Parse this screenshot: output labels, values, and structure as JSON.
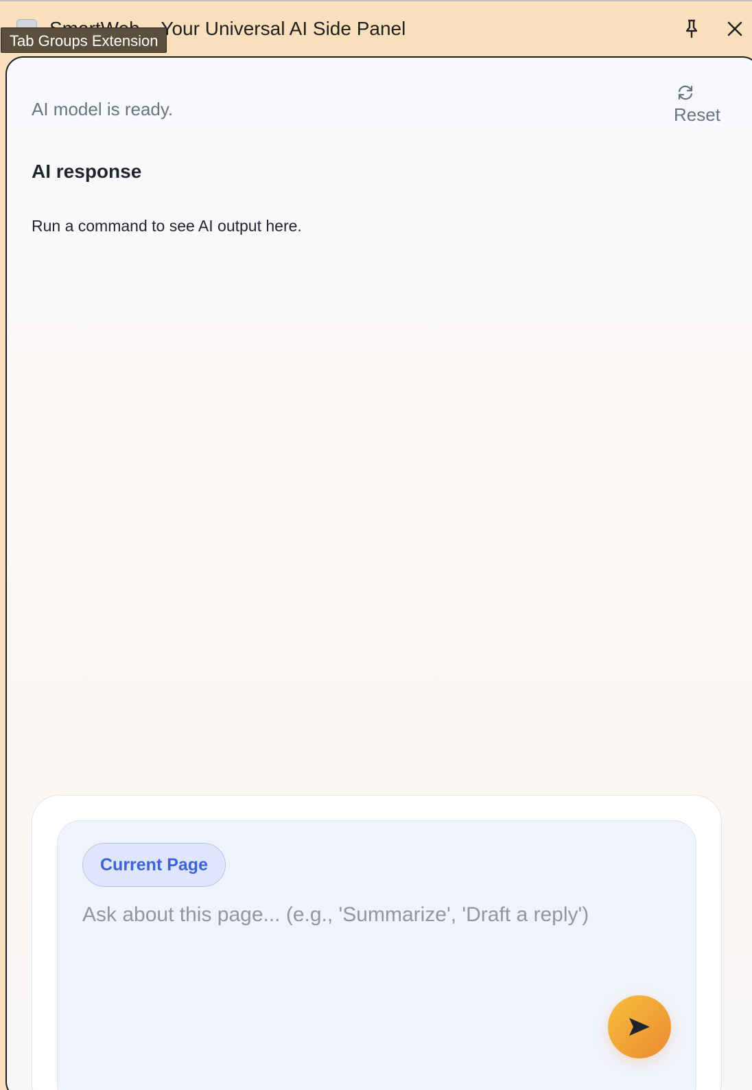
{
  "window": {
    "title": "SmartWeb – Your Universal AI Side Panel",
    "tooltip": "Tab Groups Extension",
    "pin_icon": "pin-icon",
    "close_icon": "close-icon"
  },
  "panel": {
    "status": "AI model is ready.",
    "reset_label": "Reset",
    "reset_icon": "refresh-icon",
    "response_title": "AI response",
    "response_body": "Run a command to see AI output here."
  },
  "composer": {
    "context_chip": "Current Page",
    "placeholder": "Ask about this page... (e.g., 'Summarize', 'Draft a reply')",
    "send_icon": "send-icon"
  },
  "colors": {
    "titlebar_bg": "#fadfbd",
    "chip_text": "#3b62d6",
    "send_button": "#f0a235",
    "muted_text": "#6b7280"
  }
}
